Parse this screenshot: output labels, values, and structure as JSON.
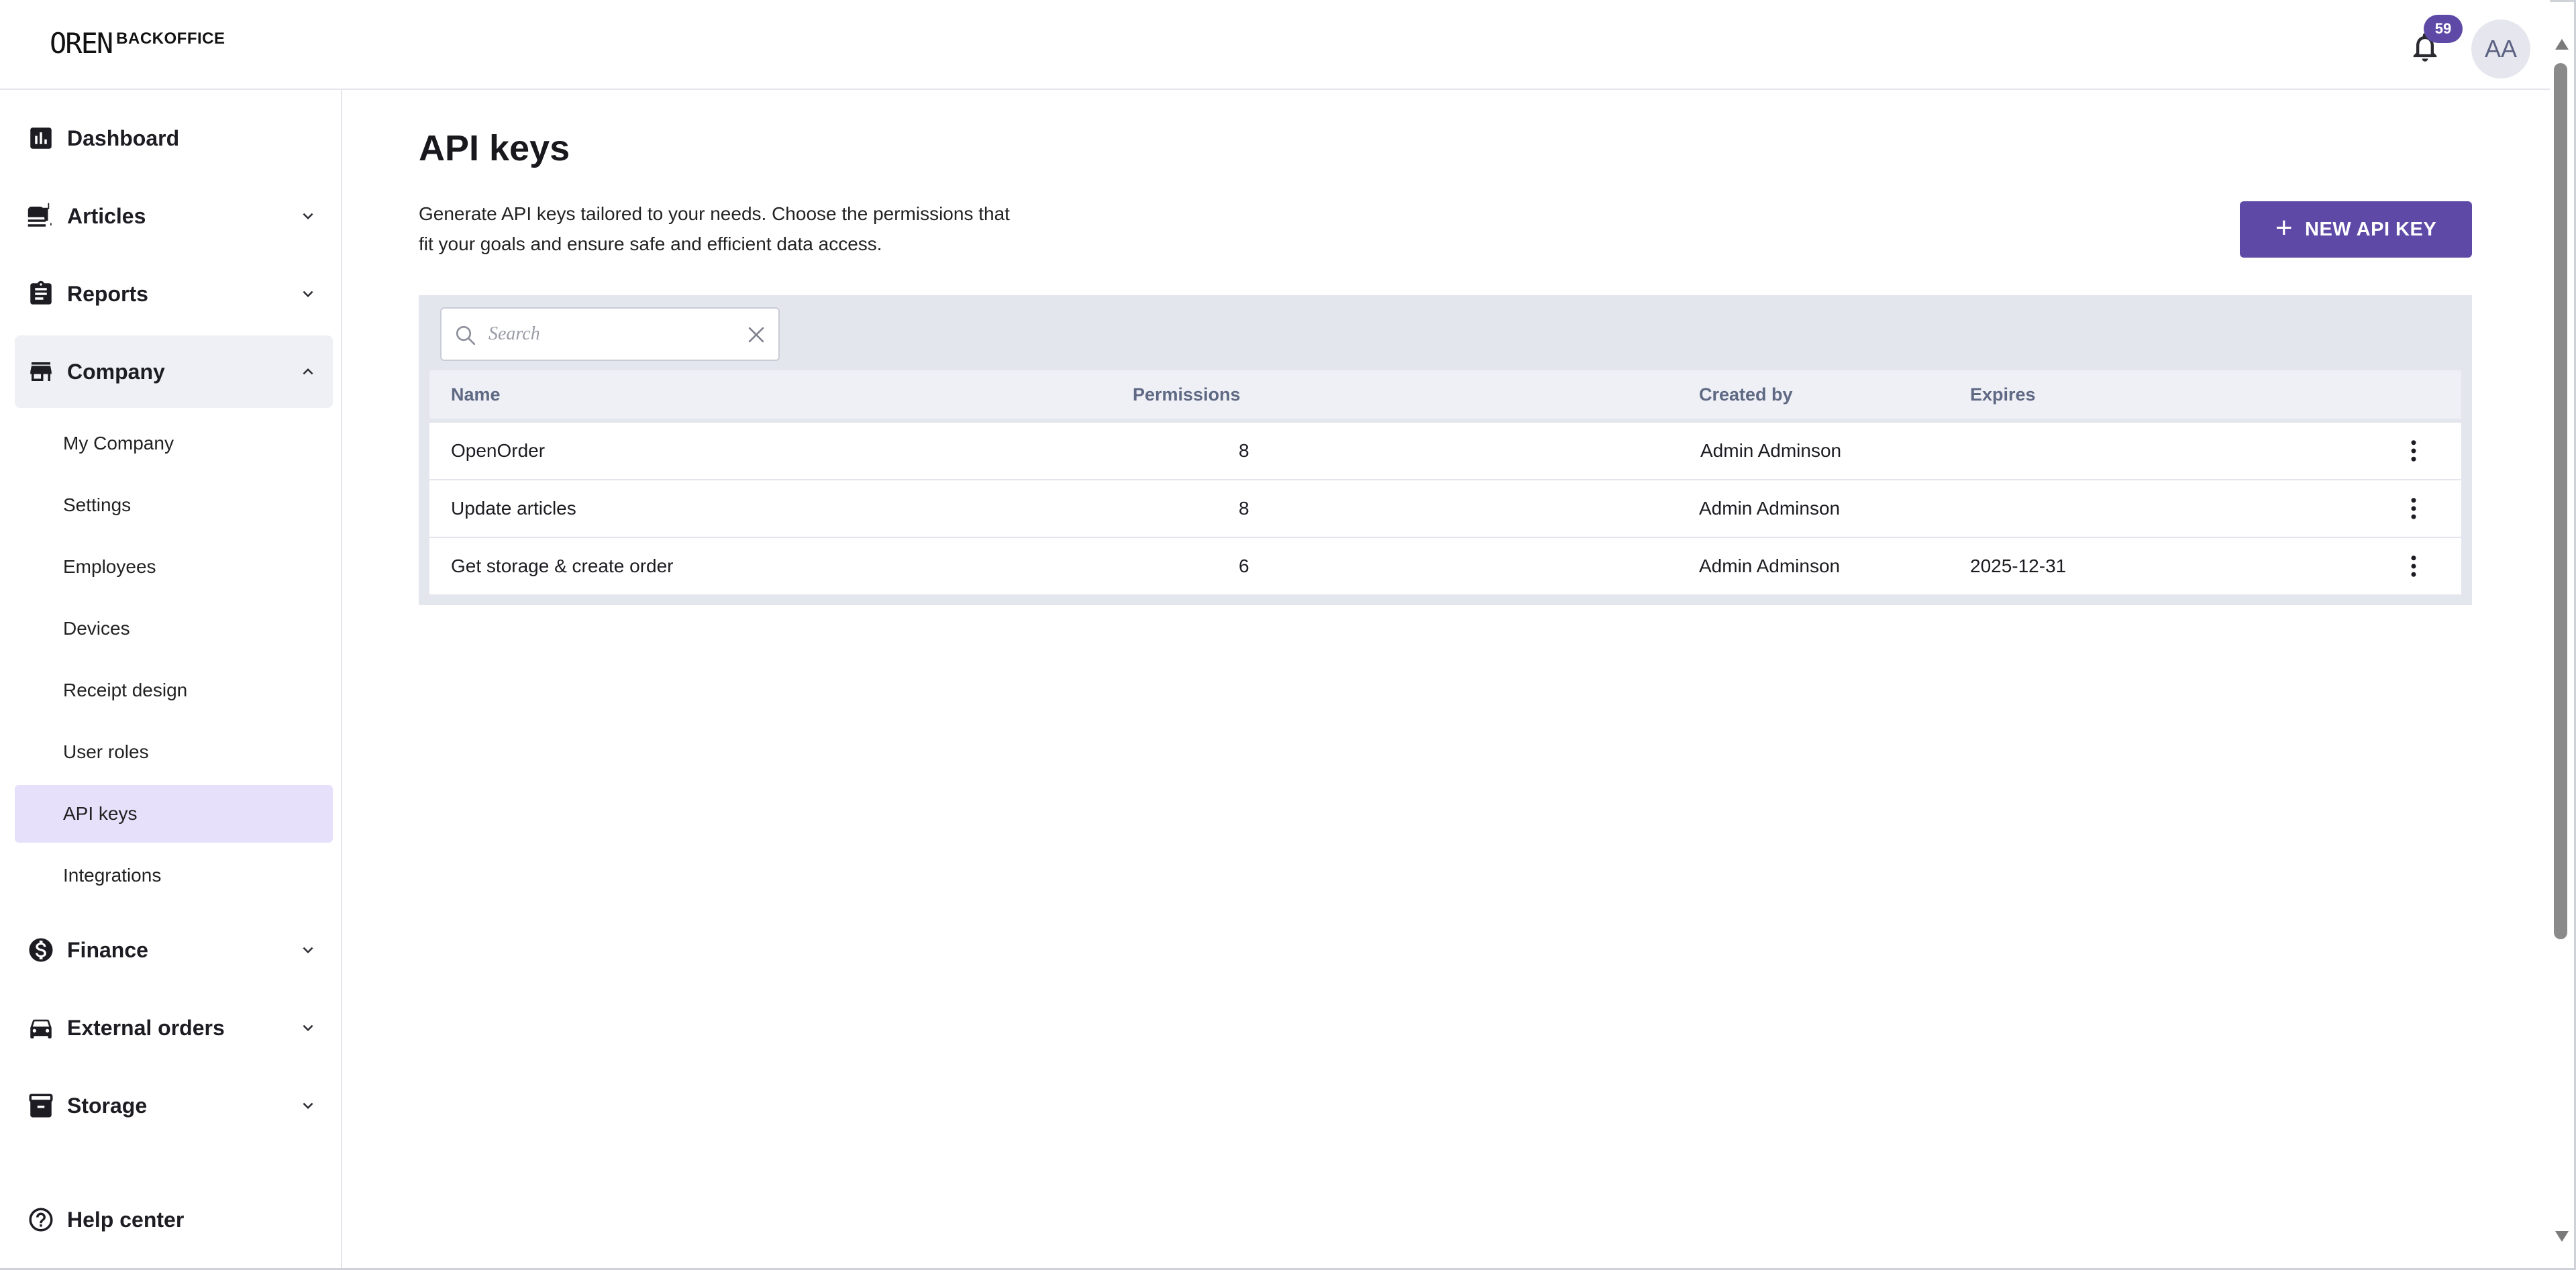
{
  "header": {
    "logo_mark": "OREN",
    "logo_text": "BACKOFFICE",
    "notification_count": "59",
    "avatar_initials": "AA"
  },
  "sidebar": {
    "items": [
      {
        "label": "Dashboard",
        "icon": "bar-chart-icon"
      },
      {
        "label": "Articles",
        "icon": "food-icon"
      },
      {
        "label": "Reports",
        "icon": "clipboard-icon"
      },
      {
        "label": "Company",
        "icon": "store-icon",
        "expanded": true
      },
      {
        "label": "Finance",
        "icon": "dollar-circle-icon"
      },
      {
        "label": "External orders",
        "icon": "car-icon"
      },
      {
        "label": "Storage",
        "icon": "archive-icon"
      }
    ],
    "company_subitems": [
      "My Company",
      "Settings",
      "Employees",
      "Devices",
      "Receipt design",
      "User roles",
      "API keys",
      "Integrations"
    ],
    "active_subitem": "API keys",
    "help_label": "Help center"
  },
  "main": {
    "title": "API keys",
    "description_line1": "Generate API keys tailored to your needs. Choose the permissions that",
    "description_line2": "fit your goals and ensure safe and efficient data access.",
    "new_button_label": "NEW API KEY",
    "search_placeholder": "Search",
    "columns": [
      "Name",
      "Permissions",
      "Created by",
      "Expires"
    ],
    "rows": [
      {
        "name": "OpenOrder",
        "permissions": "8",
        "created_by": "Admin Adminson",
        "expires": ""
      },
      {
        "name": "Update articles",
        "permissions": "8",
        "created_by": "Admin Adminson",
        "expires": ""
      },
      {
        "name": "Get storage & create order",
        "permissions": "6",
        "created_by": "Admin Adminson",
        "expires": "2025-12-31"
      }
    ]
  },
  "colors": {
    "accent": "#5e4aa6",
    "active_bg": "#e6e0fb",
    "table_panel_bg": "#e4e6ee",
    "header_text": "#5f6984"
  }
}
